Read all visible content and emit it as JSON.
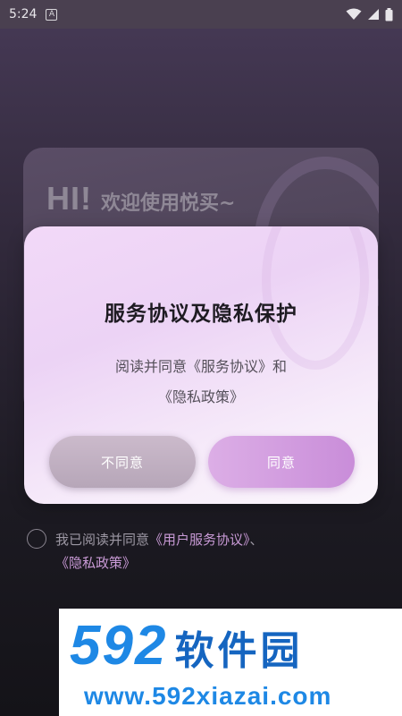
{
  "status_bar": {
    "time": "5:24",
    "notification_glyph": "A",
    "icons": [
      "wifi-icon",
      "cellular-signal-icon",
      "battery-icon"
    ]
  },
  "welcome_card": {
    "hi": "HI!",
    "subtitle": "欢迎使用悦买~"
  },
  "dialog": {
    "title": "服务协议及隐私保护",
    "body_line1": "阅读并同意《服务协议》和",
    "body_line2": "《隐私政策》",
    "disagree_label": "不同意",
    "agree_label": "同意"
  },
  "agreement": {
    "prefix": "我已阅读并同意",
    "user_service_link": "《用户服务协议》",
    "separator": "、",
    "privacy_link": "《隐私政策》",
    "checked": false
  },
  "watermark": {
    "number": "592",
    "name": "软件园",
    "url": "www.592xiazai.com"
  },
  "colors": {
    "accent": "#c98dd9",
    "link": "#c99ad6",
    "watermark_blue": "#1e88e5"
  }
}
